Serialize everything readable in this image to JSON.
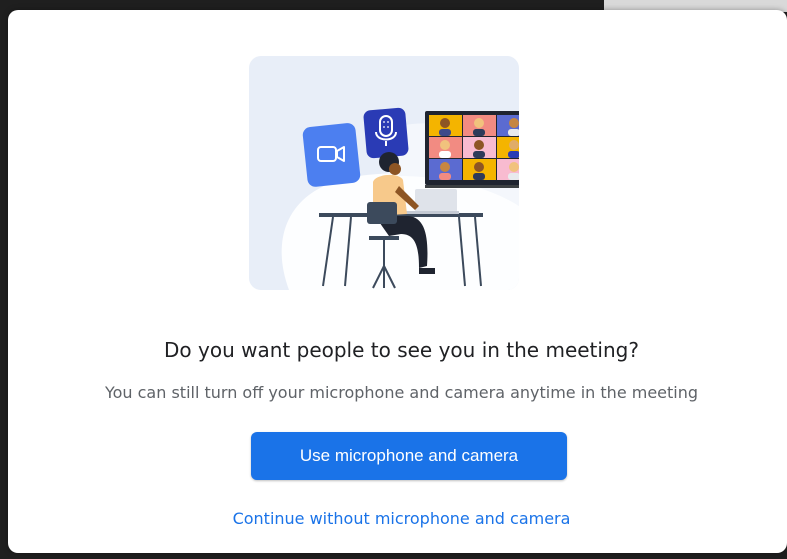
{
  "dialog": {
    "title": "Do you want people to see you in the meeting?",
    "subtitle": "You can still turn off your microphone and camera anytime in the meeting",
    "primary_button_label": "Use microphone and camera",
    "secondary_link_label": "Continue without microphone and camera"
  },
  "illustration": {
    "icons": [
      "video-camera-icon",
      "microphone-icon"
    ],
    "video_grid_tiles": 9
  },
  "colors": {
    "accent": "#1a73e8",
    "illustration_bg": "#e8eef8",
    "camera_badge": "#4c7ff0",
    "mic_badge": "#2a3bb5"
  }
}
